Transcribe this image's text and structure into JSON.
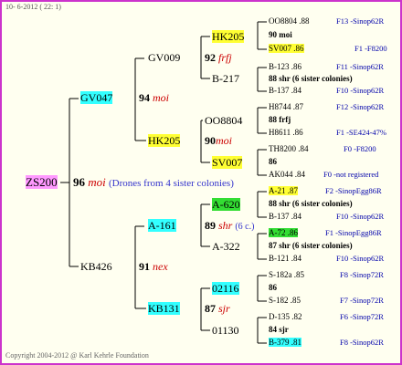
{
  "header": "10-  6-2012 ( 22:  1)",
  "footer": "Copyright 2004-2012 @ Karl Kehrle Foundation",
  "colors": {
    "frame": "#cc33cc",
    "line": "#000000",
    "bee_line": "#3333cc",
    "yellow": "#ffff33",
    "cyan": "#33ffff",
    "green": "#33dd33",
    "violet": "#ff99ff",
    "background": "#fffff0"
  },
  "root": {
    "name": "ZS200",
    "num": "96",
    "race": "moi",
    "note": "(Drones from 4 sister colonies)"
  },
  "gen2": [
    {
      "name": "GV047",
      "num": "94",
      "race": "moi"
    },
    {
      "name": "KB426",
      "num": "91",
      "race": "nex"
    }
  ],
  "gen3": [
    {
      "name": "GV009",
      "num": "92",
      "race": "frfj"
    },
    {
      "name": "HK205",
      "num": "90",
      "race": "moi"
    },
    {
      "name": "A-161",
      "num": "89",
      "race": "shr",
      "note": "(6 c.)"
    },
    {
      "name": "KB131",
      "num": "87",
      "race": "sjr"
    }
  ],
  "gen4": [
    {
      "name": "HK205"
    },
    {
      "name": "B-217"
    },
    {
      "name": "OO8804"
    },
    {
      "name": "SV007"
    },
    {
      "name": "A-620"
    },
    {
      "name": "A-322"
    },
    {
      "name": "02116"
    },
    {
      "name": "01130"
    }
  ],
  "gen5": [
    {
      "top": "OO8804 .88",
      "mid": "90 moi",
      "bot": "SV007 .86",
      "r1": "F13 -Sinop62R",
      "r2": "F1 -F8200"
    },
    {
      "top": "B-123 .86",
      "mid": "88 shr (6 sister colonies)",
      "bot": "B-137 .84",
      "r1": "F11 -Sinop62R",
      "r2": "F10 -Sinop62R"
    },
    {
      "top": "H8744 .87",
      "mid": "88 frfj",
      "bot": "H8611 .86",
      "r1": "F12 -Sinop62R",
      "r2": "F1 -SE424-47%"
    },
    {
      "top": "TH8200 .84",
      "mid": "86",
      "bot": "AK044 .84",
      "r1": "F0 -F8200",
      "r2": "F0 -not registered"
    },
    {
      "top": "A-21 .87",
      "mid": "88 shr (6 sister colonies)",
      "bot": "B-137 .84",
      "r1": "F2 -SinopEgg86R",
      "r2": "F10 -Sinop62R"
    },
    {
      "top": "A-72 .86",
      "mid": "87 shr (6 sister colonies)",
      "bot": "B-121 .84",
      "r1": "F1 -SinopEgg86R",
      "r2": "F10 -Sinop62R"
    },
    {
      "top": "S-182a .85",
      "mid": "86",
      "bot": "S-182 .85",
      "r1": "F8 -Sinop72R",
      "r2": "F7 -Sinop72R"
    },
    {
      "top": "D-135 .82",
      "mid": "84 sjr",
      "bot": "B-379 .81",
      "r1": "F6 -Sinop72R",
      "r2": "F8 -Sinop62R"
    }
  ]
}
